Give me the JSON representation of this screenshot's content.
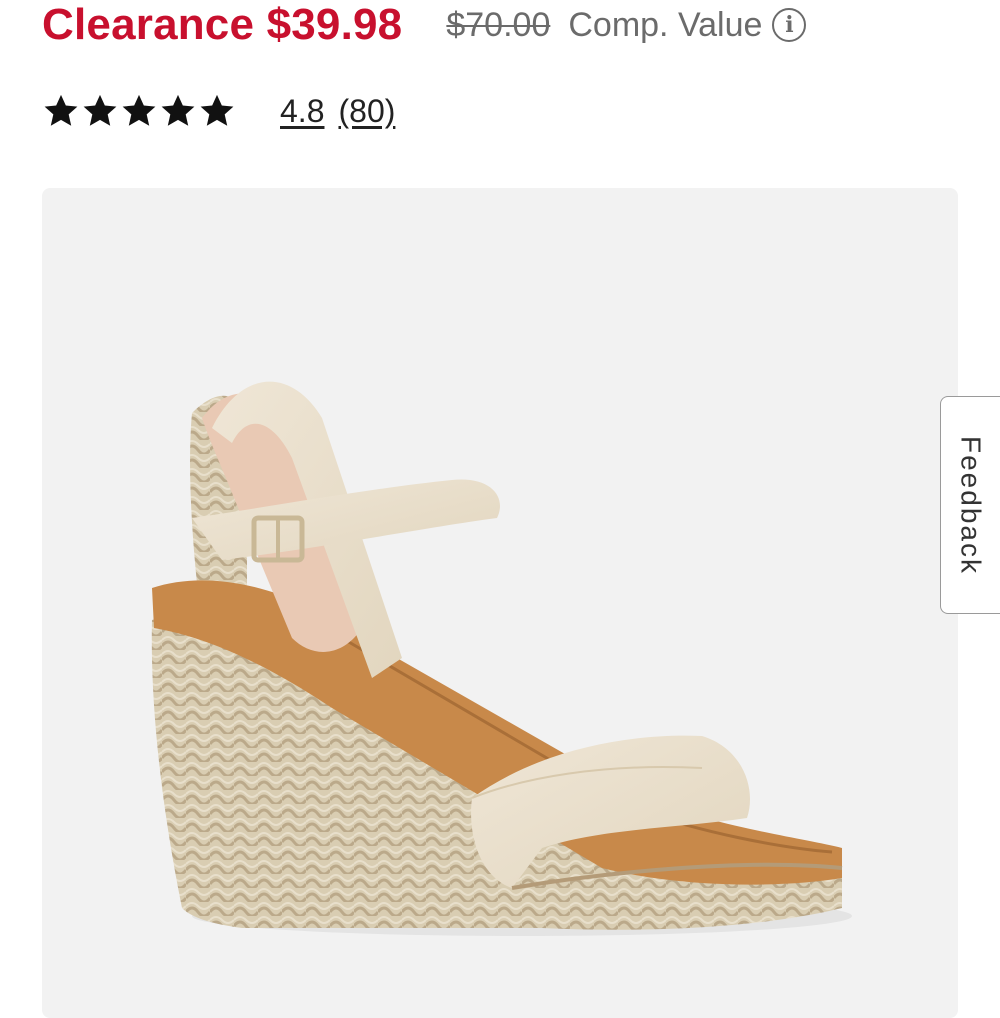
{
  "pricing": {
    "sale_label": "Clearance $39.98",
    "original_price": "$70.00",
    "comp_value_label": "Comp. Value",
    "info_icon": "info-circle-icon",
    "info_glyph": "i",
    "sale_color": "#c8102e"
  },
  "rating": {
    "stars_value": 4.8,
    "stars_max": 5,
    "star_icon": "star-icon",
    "value": "4.8",
    "count": "(80)"
  },
  "product_image": {
    "alt": "Beige espadrille wedge sandal with ankle strap and buckle",
    "background": "#f2f2f2"
  },
  "feedback": {
    "label": "Feedback"
  }
}
